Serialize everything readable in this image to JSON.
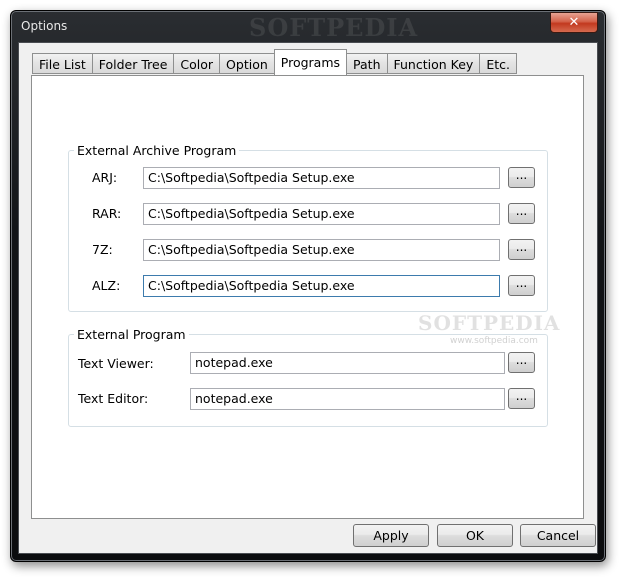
{
  "window": {
    "title": "Options",
    "brand": "SOFTPEDIA",
    "close_glyph": "✕"
  },
  "tabs": [
    {
      "label": "File List"
    },
    {
      "label": "Folder Tree"
    },
    {
      "label": "Color"
    },
    {
      "label": "Option"
    },
    {
      "label": "Programs",
      "active": true
    },
    {
      "label": "Path"
    },
    {
      "label": "Function Key"
    },
    {
      "label": "Etc."
    }
  ],
  "archive_group": {
    "legend": "External Archive Program",
    "rows": [
      {
        "label": "ARJ:",
        "value": "C:\\Softpedia\\Softpedia Setup.exe",
        "button": "..."
      },
      {
        "label": "RAR:",
        "value": "C:\\Softpedia\\Softpedia Setup.exe",
        "button": "..."
      },
      {
        "label": "7Z:",
        "value": "C:\\Softpedia\\Softpedia Setup.exe",
        "button": "..."
      },
      {
        "label": "ALZ:",
        "value": "C:\\Softpedia\\Softpedia Setup.exe",
        "button": "..."
      }
    ]
  },
  "program_group": {
    "legend": "External Program",
    "rows": [
      {
        "label": "Text Viewer:",
        "value": "notepad.exe",
        "button": "..."
      },
      {
        "label": "Text Editor:",
        "value": "notepad.exe",
        "button": "..."
      }
    ]
  },
  "watermark": {
    "text": "SOFTPEDIA",
    "sub": "www.softpedia.com"
  },
  "footer": {
    "apply": "Apply",
    "ok": "OK",
    "cancel": "Cancel"
  }
}
